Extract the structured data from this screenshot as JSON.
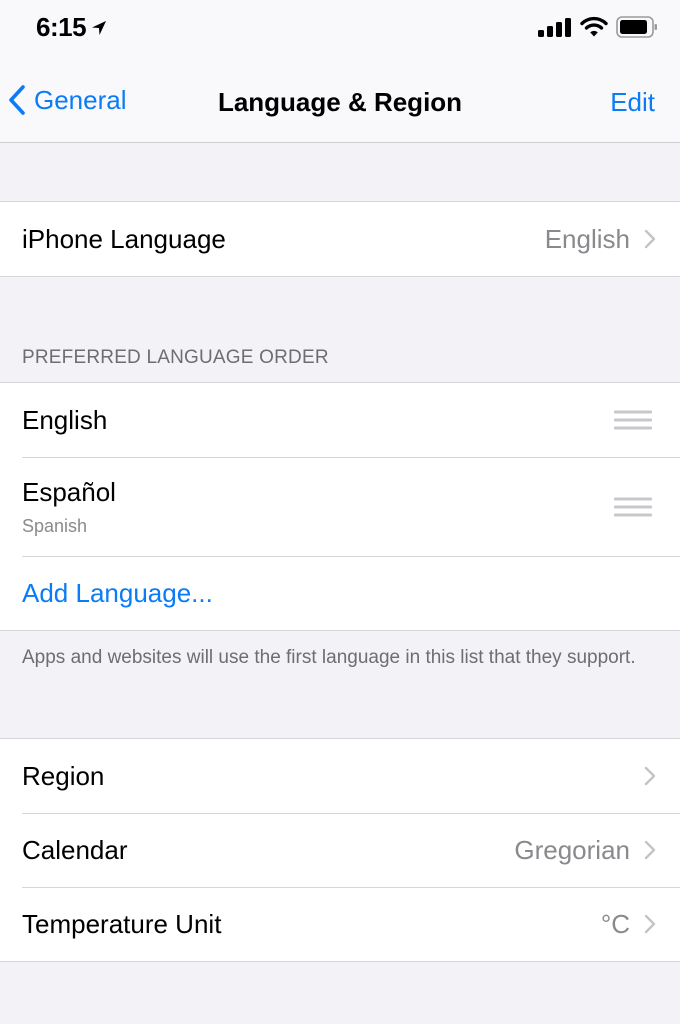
{
  "status_bar": {
    "time": "6:15",
    "icons": [
      "location-arrow-icon",
      "cellular-signal-icon",
      "wifi-icon",
      "battery-icon"
    ]
  },
  "nav": {
    "back_label": "General",
    "title": "Language & Region",
    "edit_label": "Edit"
  },
  "iphone_language": {
    "label": "iPhone Language",
    "value": "English"
  },
  "preferred": {
    "header": "PREFERRED LANGUAGE ORDER",
    "languages": [
      {
        "name": "English",
        "subtitle": ""
      },
      {
        "name": "Español",
        "subtitle": "Spanish"
      }
    ],
    "add_label": "Add Language...",
    "footer": "Apps and websites will use the first language in this list that they support."
  },
  "region_group": [
    {
      "label": "Region",
      "value": ""
    },
    {
      "label": "Calendar",
      "value": "Gregorian"
    },
    {
      "label": "Temperature Unit",
      "value": "°C"
    }
  ],
  "colors": {
    "accent": "#0a7cf5",
    "background": "#f2f2f7",
    "secondary_text": "#8a8a8e"
  }
}
